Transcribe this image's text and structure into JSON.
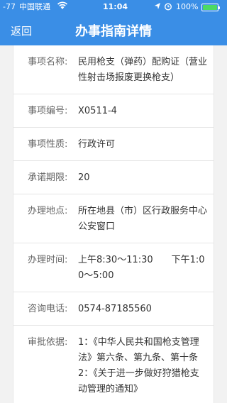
{
  "status_bar": {
    "signal": "-77",
    "carrier": "中国联通",
    "time": "11:04",
    "battery": "100%"
  },
  "header": {
    "back_label": "返回",
    "title": "办事指南详情",
    "background": "#3a8ee6"
  },
  "details": [
    {
      "label": "事项名称:",
      "value": "民用枪支（弹药）配购证（营业性射击场报废更换枪支）"
    },
    {
      "label": "事项编号:",
      "value": "X0511-4"
    },
    {
      "label": "事项性质:",
      "value": "行政许可"
    },
    {
      "label": "承诺期限:",
      "value": "20"
    },
    {
      "label": "办理地点:",
      "value": "所在地县（市）区行政服务中心公安窗口"
    },
    {
      "label": "办理时间:",
      "value": "上午8:30～11:30　　下午1:00～5:00"
    },
    {
      "label": "咨询电话:",
      "value": "0574-87185560"
    },
    {
      "label": "审批依据:",
      "value": "1：《中华人民共和国枪支管理法》第六条、第九条、第十条2：《关于进一步做好狩猎枪支动管理的通知》"
    }
  ]
}
